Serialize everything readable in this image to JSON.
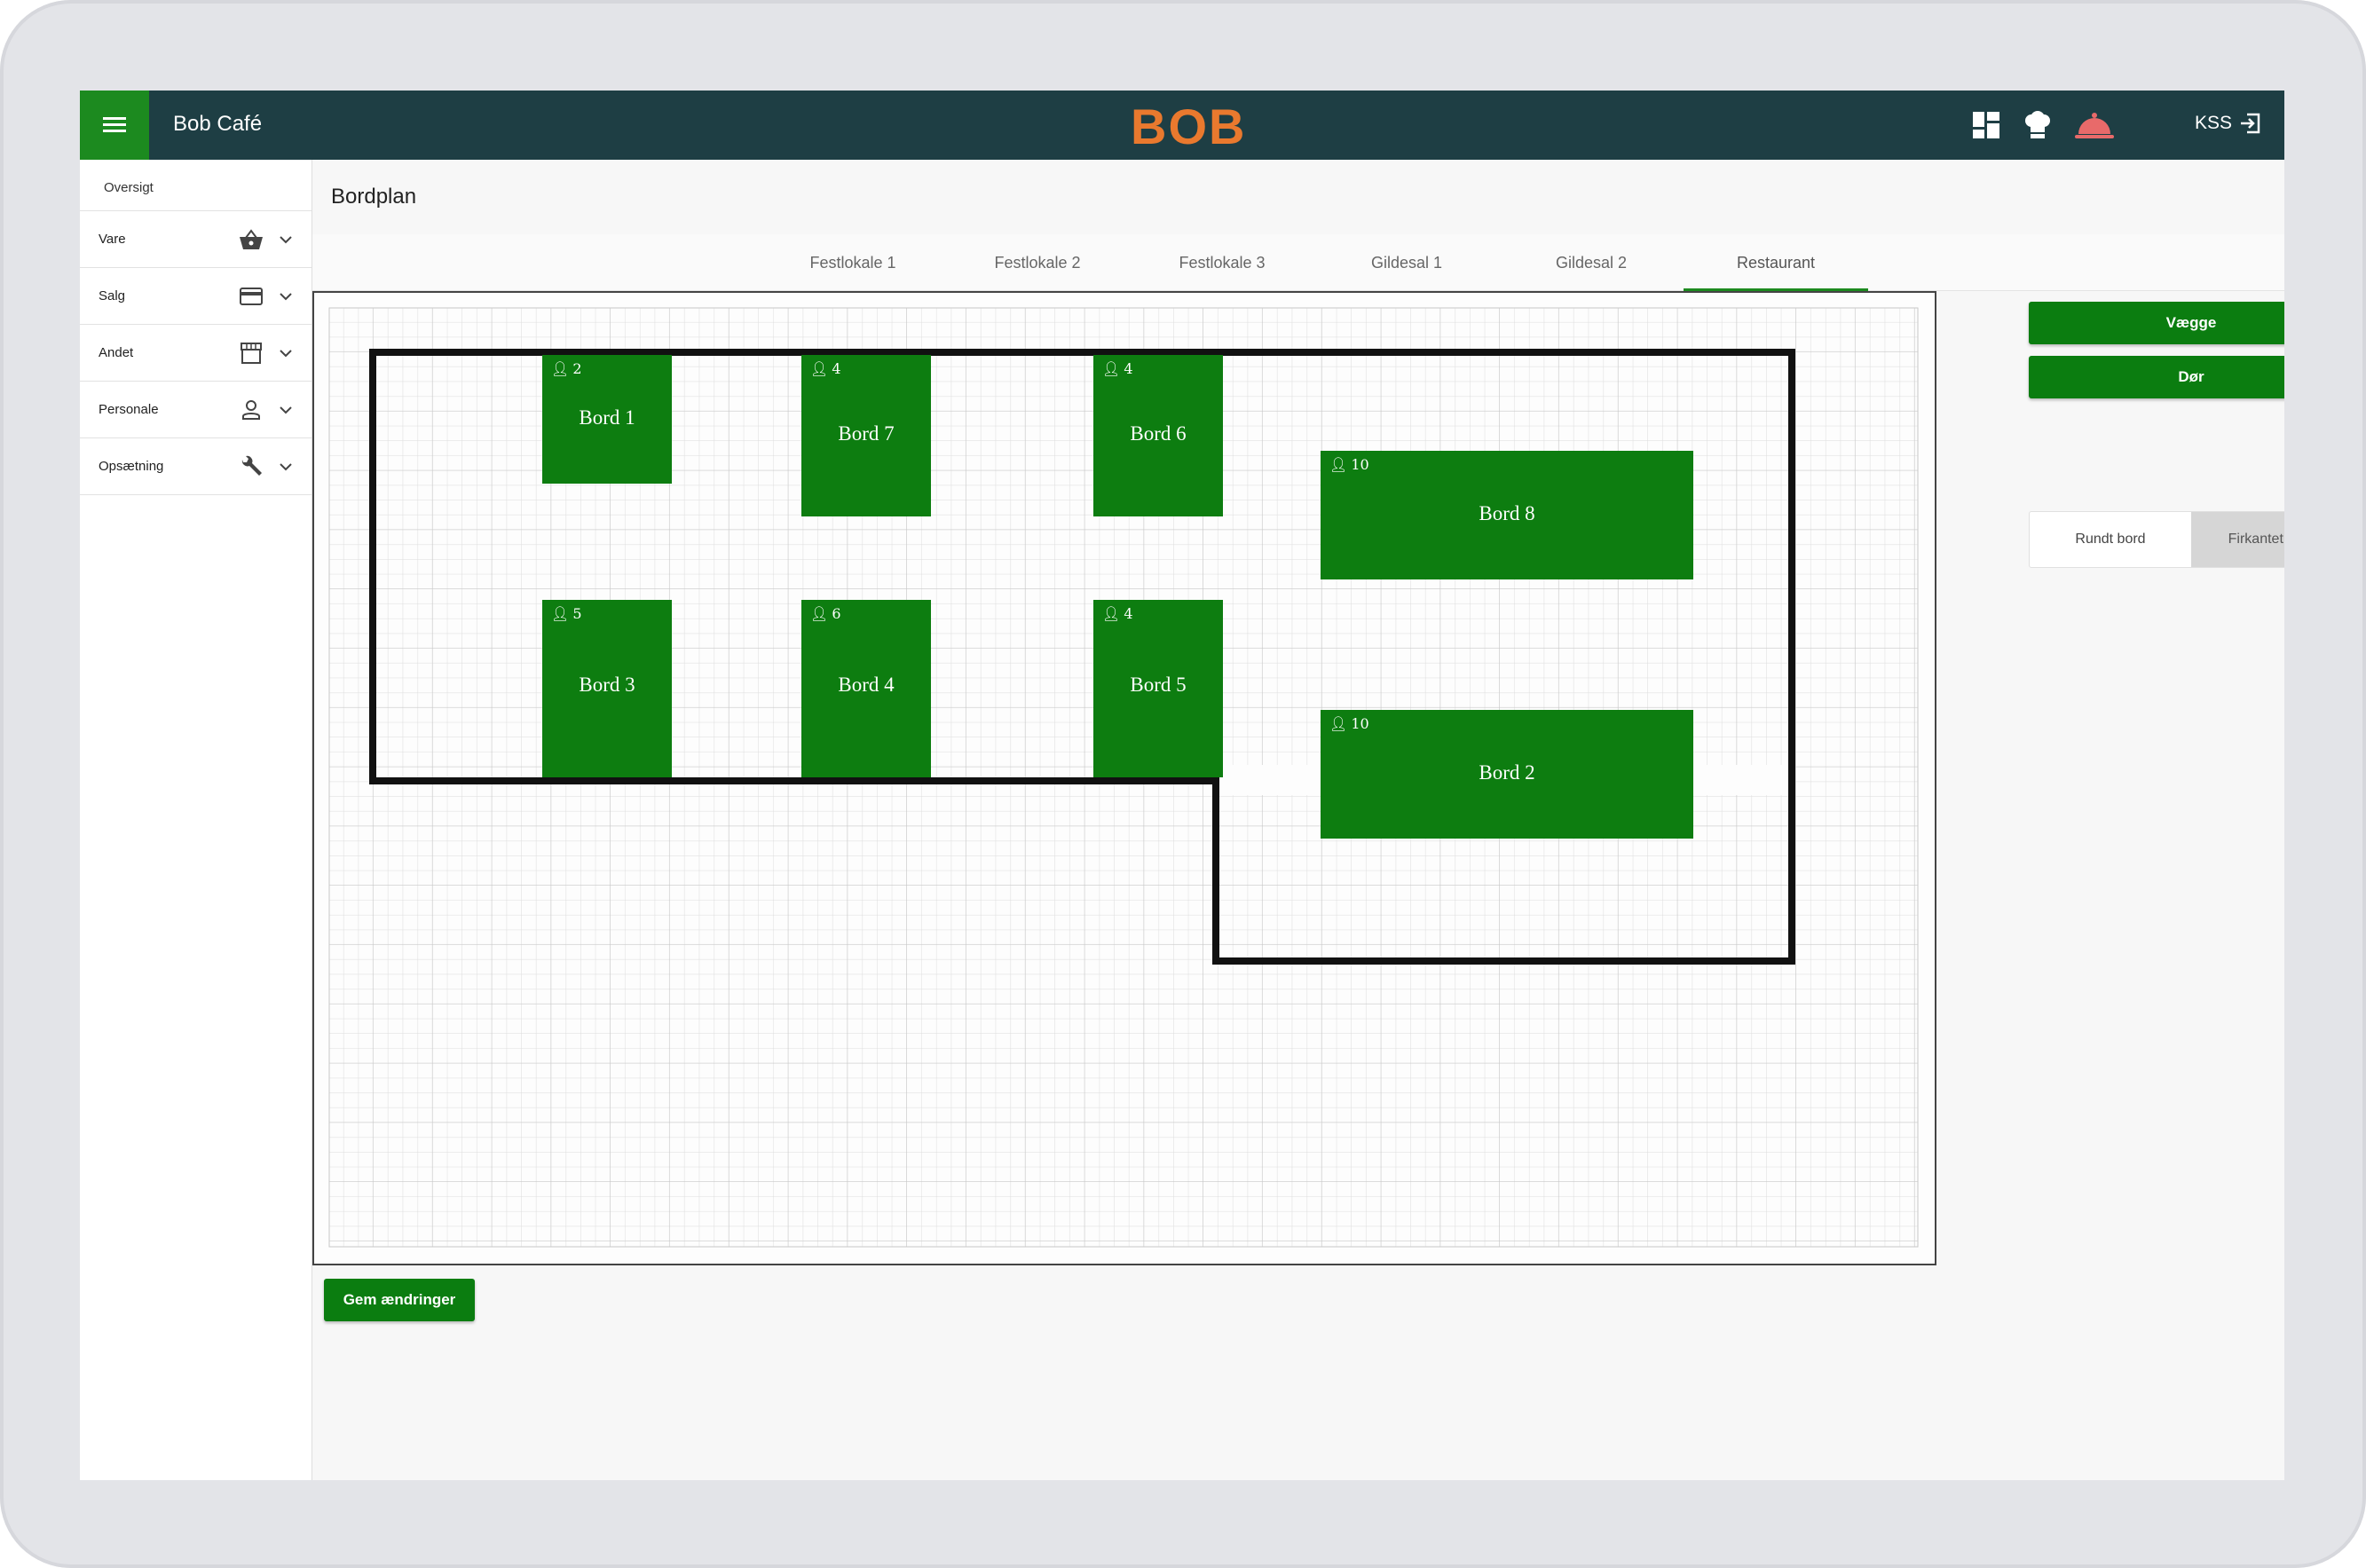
{
  "app": {
    "title": "Bob Café",
    "logo": "BOB",
    "user": "KSS"
  },
  "topbar_icons": [
    "grid-icon",
    "chef-hat-icon",
    "cloche-icon",
    "logout-icon"
  ],
  "sidebar": {
    "overview": "Oversigt",
    "items": [
      {
        "label": "Vare",
        "icon": "basket-icon"
      },
      {
        "label": "Salg",
        "icon": "card-icon"
      },
      {
        "label": "Andet",
        "icon": "store-icon"
      },
      {
        "label": "Personale",
        "icon": "person-icon"
      },
      {
        "label": "Opsætning",
        "icon": "wrench-icon"
      }
    ]
  },
  "page": {
    "title": "Bordplan"
  },
  "tabs": [
    "Festlokale 1",
    "Festlokale 2",
    "Festlokale 3",
    "Gildesal 1",
    "Gildesal 2",
    "Restaurant"
  ],
  "active_tab": "Restaurant",
  "tables": [
    {
      "name": "Bord 1",
      "seats": "2"
    },
    {
      "name": "Bord 7",
      "seats": "4"
    },
    {
      "name": "Bord 6",
      "seats": "4"
    },
    {
      "name": "Bord 8",
      "seats": "10"
    },
    {
      "name": "Bord 3",
      "seats": "5"
    },
    {
      "name": "Bord 4",
      "seats": "6"
    },
    {
      "name": "Bord 5",
      "seats": "4"
    },
    {
      "name": "Bord 2",
      "seats": "10"
    }
  ],
  "actions": {
    "save": "Gem ændringer",
    "walls": "Vægge",
    "door": "Dør",
    "round_table": "Rundt bord",
    "square_table": "Firkantet bord"
  },
  "colors": {
    "topbar": "#1e3e44",
    "accent_green": "#1c8a1f",
    "table_green": "#0d7d10",
    "logo_orange": "#e9792e",
    "cloche_red": "#e86a6a"
  }
}
